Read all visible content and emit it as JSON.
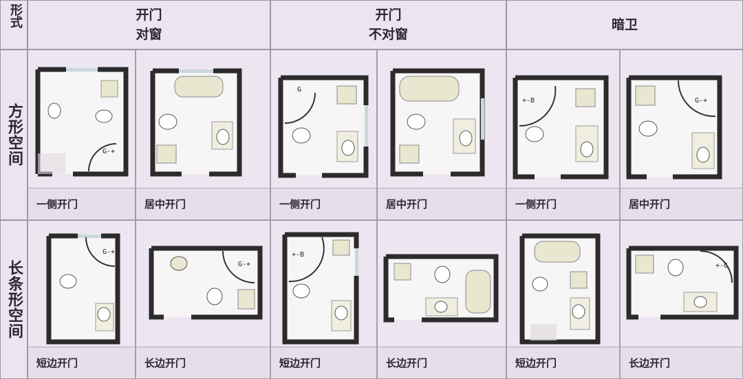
{
  "header": {
    "corner": "形式",
    "col1_line1": "开门",
    "col1_line2": "对窗",
    "col2_line1": "开门",
    "col2_line2": "不对窗",
    "col3": "暗卫"
  },
  "rows": {
    "square": "方形空间",
    "long": "长条形空间"
  },
  "cells_row1": [
    "一侧开门",
    "居中开门",
    "一侧开门",
    "居中开门",
    "一侧开门",
    "居中开门"
  ],
  "cells_row2": [
    "短边开门",
    "长边开门",
    "短边开门",
    "长边开门",
    "短边开门",
    "长边开门"
  ],
  "colors": {
    "wall": "#2b2b2b",
    "floor": "#f7f5f6",
    "window": "#c9d8de",
    "fixture": "#e8e7cf",
    "background": "#e4dde8"
  },
  "icons": [
    "toilet-icon",
    "washbasin-icon",
    "bathtub-icon",
    "shower-icon",
    "door-swing-icon",
    "window-icon"
  ]
}
